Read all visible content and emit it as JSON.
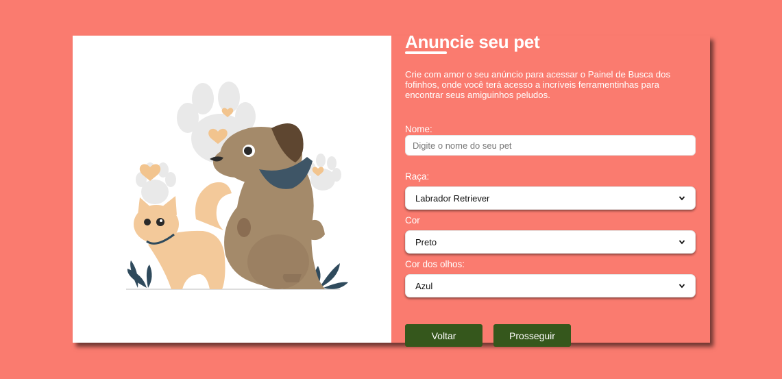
{
  "form": {
    "title": "Anuncie seu pet",
    "description": "Crie com amor o seu anúncio para acessar o Painel de Busca dos fofinhos, onde você terá acesso a incríveis ferramentinhas para encontrar seus amiguinhos peludos.",
    "name_label": "Nome:",
    "name_placeholder": "Digite o nome do seu pet",
    "name_value": "",
    "breed_label": "Raça:",
    "breed_value": "Labrador Retriever",
    "color_label": "Cor",
    "color_value": "Preto",
    "eye_color_label": "Cor dos olhos:",
    "eye_color_value": "Azul",
    "back_label": "Voltar",
    "next_label": "Prosseguir"
  },
  "colors": {
    "background": "#fa7b6f",
    "panel": "#ffffff",
    "button": "#35571c",
    "text": "#ffffff"
  },
  "illustration": {
    "icon": "dog-and-cat-illustration"
  }
}
